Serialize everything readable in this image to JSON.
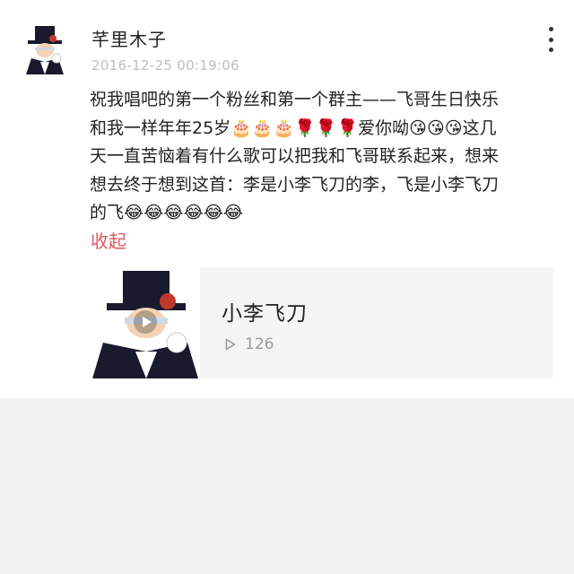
{
  "post": {
    "username": "芊里木子",
    "timestamp": "2016-12-25 00:19:06",
    "text_parts": [
      "祝我唱吧的第一个粉丝和第一个群主——飞哥生日快乐和我一样年年25岁",
      "🎂🎂🎂🌹🌹🌹",
      "爱你呦",
      "😘😘😘",
      "这几天一直苦恼着有什么歌可以把我和飞哥联系起来，想来想去终于想到这首：李是小李飞刀的李，飞是小李飞刀的飞",
      "😂😂😂😂😂😂"
    ],
    "collapse_label": "收起"
  },
  "media": {
    "title": "小李飞刀",
    "play_count": "126"
  },
  "icons": {
    "more": "more-vertical-icon",
    "play": "play-icon",
    "play_count": "play-count-icon"
  },
  "colors": {
    "accent": "#e05a5f",
    "timestamp": "#bdbdbd",
    "background": "#f2f2f2"
  }
}
